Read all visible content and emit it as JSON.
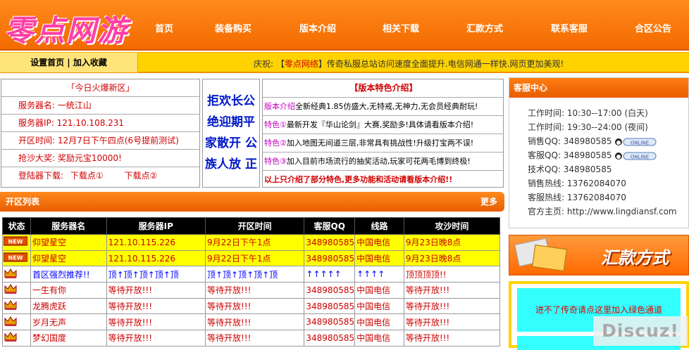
{
  "header": {
    "logo": "零点网游",
    "nav": [
      "首页",
      "装备购买",
      "版本介绍",
      "相关下载",
      "汇款方式",
      "联系客服",
      "合区公告"
    ]
  },
  "subbar": {
    "home": "设置首页",
    "sep": "|",
    "fav": "加入收藏",
    "news_prefix": "庆祝: 【",
    "news_site": "零点网络",
    "news_text": "】传奇私服总站访问速度全面提升.电信网通一样快.网页更加美观!"
  },
  "today": {
    "title": "「今日火爆新区」",
    "server": "服务器名:   一统江山",
    "ip": "服务器IP:  121.10.108.231",
    "time": "开区时间:  12月7日下午四点(6号提前测试)",
    "reward": "抢沙大奖:  奖励元宝10000!",
    "download_label": "登陆器下载:",
    "download1": "下载点①",
    "download2": "下载点②"
  },
  "slogan": [
    "拒欢长公",
    "绝迎期平",
    "家散开 公",
    "族人放 正"
  ],
  "features": {
    "title": "【版本特色介绍】",
    "rows": [
      {
        "tag": "版本介绍",
        "text": "全新经典1.85仿盛大,无特戒,无神力,无会员经典耐玩!"
      },
      {
        "tag": "特色①",
        "text": "最新开发『华山论剑』大赛,奖励多!具体请看版本介绍!"
      },
      {
        "tag": "特色②",
        "text": "加入地图无间道三层,非常具有挑战性!升级打宝两不误!"
      },
      {
        "tag": "特色③",
        "text": "加入目前市场流行的抽奖活动,玩家可花两毛博到终极!"
      }
    ],
    "footer": "以上只介绍了部分特色,更多功能和活动请看版本介绍!!"
  },
  "service": {
    "title": "客服中心",
    "lines": [
      "工作时间: 10:30--17:00 (白天)",
      "工作时间: 19:30--24:00 (夜间)",
      "销售QQ: 348980585",
      "客服QQ: 348980585",
      "技术QQ: 348980585",
      "销售热线: 13762084070",
      "客服热线: 13762084070",
      "官方主页: http://www.lingdiansf.com"
    ],
    "online_badge": "ONLINE"
  },
  "list": {
    "title": "开区列表",
    "more": "更多",
    "headers": [
      "状态",
      "服务器名",
      "服务器IP",
      "开区时间",
      "客服QQ",
      "线路",
      "攻沙时间"
    ],
    "rows": [
      {
        "kind": "hot",
        "name": "仰望星空",
        "ip": "121.10.115.226",
        "time": "9月22日下午1点",
        "qq": "348980585",
        "line": "中国电信",
        "siege": "9月23日晚8点"
      },
      {
        "kind": "hot",
        "name": "仰望星空",
        "ip": "121.10.115.226",
        "time": "9月22日下午1点",
        "qq": "348980585",
        "line": "中国电信",
        "siege": "9月23日晚8点"
      },
      {
        "kind": "blue",
        "name": "首区强烈推荐!!",
        "ip": "顶↑顶↑顶↑顶↑顶",
        "time": "顶↑顶↑顶↑顶↑顶",
        "qq": "↑↑↑↑↑",
        "line": "↑↑↑↑",
        "siege": "顶顶顶顶!!"
      },
      {
        "kind": "norm",
        "name": "一生有你",
        "ip": "等待开放!!!",
        "time": "等待开放!!!",
        "qq": "348980585",
        "line": "中国电信",
        "siege": "等待开放!!!"
      },
      {
        "kind": "norm",
        "name": "龙腾虎跃",
        "ip": "等待开放!!!",
        "time": "等待开放!!!",
        "qq": "348980585",
        "line": "中国电信",
        "siege": "等待开放!!!"
      },
      {
        "kind": "norm",
        "name": "岁月无声",
        "ip": "等待开放!!!",
        "time": "等待开放!!!",
        "qq": "348980585",
        "line": "中国电信",
        "siege": "等待开放!!!"
      },
      {
        "kind": "norm",
        "name": "梦幻国度",
        "ip": "等待开放!!!",
        "time": "等待开放!!!",
        "qq": "348980585",
        "line": "中国电信",
        "siege": "等待开放!!!"
      }
    ],
    "new_badge": "NEW"
  },
  "remit": {
    "title": "汇款方式"
  },
  "green_notice": "进不了传奇请点这里加入绿色通道",
  "watermark": "Discuz!",
  "colors": {
    "header_orange": "#f36a00",
    "logo_pink": "#ff3fa6",
    "subbar_yellow": "#ffd200",
    "text_red": "#d00000",
    "slogan_blue": "#0018c8",
    "hot_row": "#ffff00",
    "green_box": "#33ffff"
  }
}
